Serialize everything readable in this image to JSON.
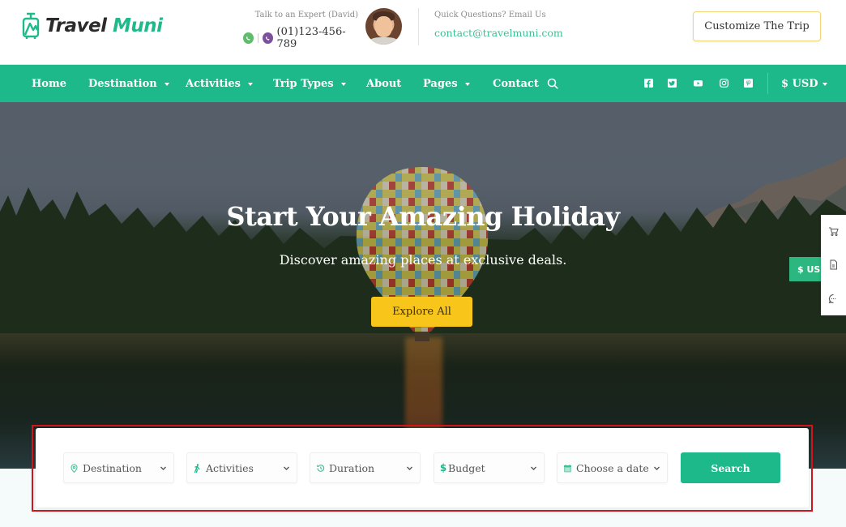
{
  "brand": {
    "name_part1": "Travel",
    "name_part2": "Muni",
    "primary_color": "#1db98a",
    "accent_color": "#f8c51a"
  },
  "header": {
    "expert_label": "Talk to an Expert (David)",
    "phone": "(01)123-456-789",
    "email_label": "Quick Questions? Email Us",
    "email": "contact@travelmuni.com",
    "customize_button": "Customize The Trip"
  },
  "nav": {
    "items": [
      {
        "label": "Home",
        "has_dropdown": false
      },
      {
        "label": "Destination",
        "has_dropdown": true
      },
      {
        "label": "Activities",
        "has_dropdown": true
      },
      {
        "label": "Trip Types",
        "has_dropdown": true
      },
      {
        "label": "About",
        "has_dropdown": false
      },
      {
        "label": "Pages",
        "has_dropdown": true
      },
      {
        "label": "Contact",
        "has_dropdown": false
      }
    ],
    "social_icons": [
      "facebook-icon",
      "twitter-icon",
      "youtube-icon",
      "instagram-icon",
      "pinterest-icon"
    ],
    "currency": "$ USD"
  },
  "hero": {
    "title": "Start Your Amazing Holiday",
    "subtitle": "Discover amazing places at exclusive deals.",
    "cta": "Explore All"
  },
  "side_tools": {
    "currency_tab": "$ USD",
    "icons": [
      "cart-icon",
      "document-icon",
      "chat-icon"
    ]
  },
  "search": {
    "fields": [
      {
        "label": "Destination",
        "icon": "map-pin-icon"
      },
      {
        "label": "Activities",
        "icon": "hiker-icon"
      },
      {
        "label": "Duration",
        "icon": "history-clock-icon"
      },
      {
        "label": "Budget",
        "icon": "dollar-icon"
      },
      {
        "label": "Choose a date",
        "icon": "calendar-icon"
      }
    ],
    "button": "Search"
  }
}
